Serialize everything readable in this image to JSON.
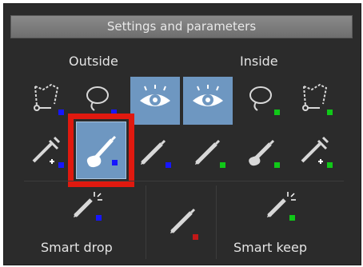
{
  "panel": {
    "title": "Settings and parameters",
    "outside_label": "Outside",
    "inside_label": "Inside",
    "smart_drop_label": "Smart drop",
    "smart_keep_label": "Smart keep"
  },
  "colors": {
    "panel_bg": "#2b2b2b",
    "active_tile": "#6e97c1",
    "outside_marker": "#1616ff",
    "inside_marker": "#10c818",
    "neutral_marker": "#c21818",
    "highlight_border": "#e0190f"
  },
  "tools": {
    "row1": [
      "polygon-lasso-icon",
      "lasso-icon",
      "eye-icon",
      "eye-icon",
      "lasso-icon",
      "polygon-lasso-icon"
    ],
    "row2": [
      "dropper-plus-icon",
      "brush-fill-icon",
      "pencil-icon",
      "pencil-icon",
      "brush-fill-icon",
      "dropper-plus-icon"
    ],
    "row3": [
      "magic-pencil-icon",
      "pencil-icon",
      "magic-pencil-icon"
    ]
  }
}
